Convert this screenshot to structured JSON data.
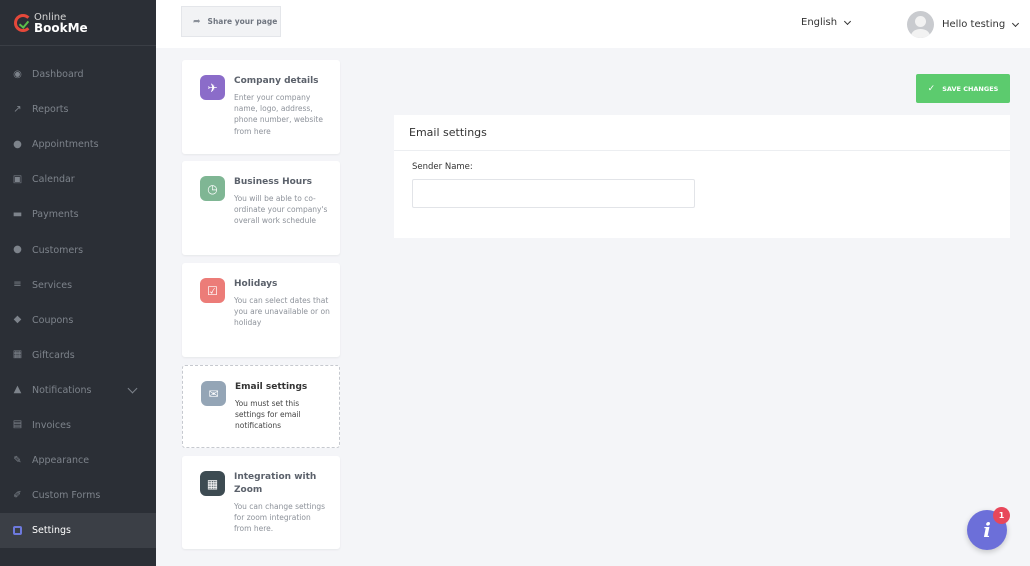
{
  "brand": {
    "line1": "Online",
    "line2": "BookMe"
  },
  "sidebar": {
    "items": [
      {
        "label": "Dashboard",
        "icon": "dashboard-icon"
      },
      {
        "label": "Reports",
        "icon": "chart-icon"
      },
      {
        "label": "Appointments",
        "icon": "clock-icon"
      },
      {
        "label": "Calendar",
        "icon": "calendar-icon"
      },
      {
        "label": "Payments",
        "icon": "card-icon"
      },
      {
        "label": "Customers",
        "icon": "users-icon"
      },
      {
        "label": "Services",
        "icon": "list-icon"
      },
      {
        "label": "Coupons",
        "icon": "tag-icon"
      },
      {
        "label": "Giftcards",
        "icon": "gift-icon"
      },
      {
        "label": "Notifications",
        "icon": "bell-icon"
      },
      {
        "label": "Invoices",
        "icon": "invoice-icon"
      },
      {
        "label": "Appearance",
        "icon": "brush-icon"
      },
      {
        "label": "Custom Forms",
        "icon": "form-icon"
      },
      {
        "label": "Settings",
        "icon": "gear-icon"
      }
    ],
    "active": "Settings"
  },
  "header": {
    "share_label": "Share your page",
    "language": "English",
    "greeting": "Hello testing"
  },
  "settings_cards": [
    {
      "title": "Company details",
      "desc": "Enter your company name, logo, address, phone number, website from here",
      "icon": "rocket-icon",
      "color": "#8b6cc9"
    },
    {
      "title": "Business Hours",
      "desc": "You will be able to co-ordinate your company's overall work schedule",
      "icon": "clock-icon",
      "color": "#7fb694"
    },
    {
      "title": "Holidays",
      "desc": "You can select dates that you are unavailable or on holiday",
      "icon": "calendar-check-icon",
      "color": "#ec7c78"
    },
    {
      "title": "Email settings",
      "desc": "You must set this settings for email notifications",
      "icon": "envelope-open-icon",
      "color": "#94a5b6"
    },
    {
      "title": "Integration with Zoom",
      "desc": "You can change settings for zoom integration from here.",
      "icon": "qr-icon",
      "color": "#3d4b52"
    }
  ],
  "main": {
    "save_label": "SAVE CHANGES",
    "panel_title": "Email settings",
    "field_label": "Sender Name:",
    "field_value": ""
  },
  "help": {
    "badge_count": "1",
    "label": "i"
  }
}
